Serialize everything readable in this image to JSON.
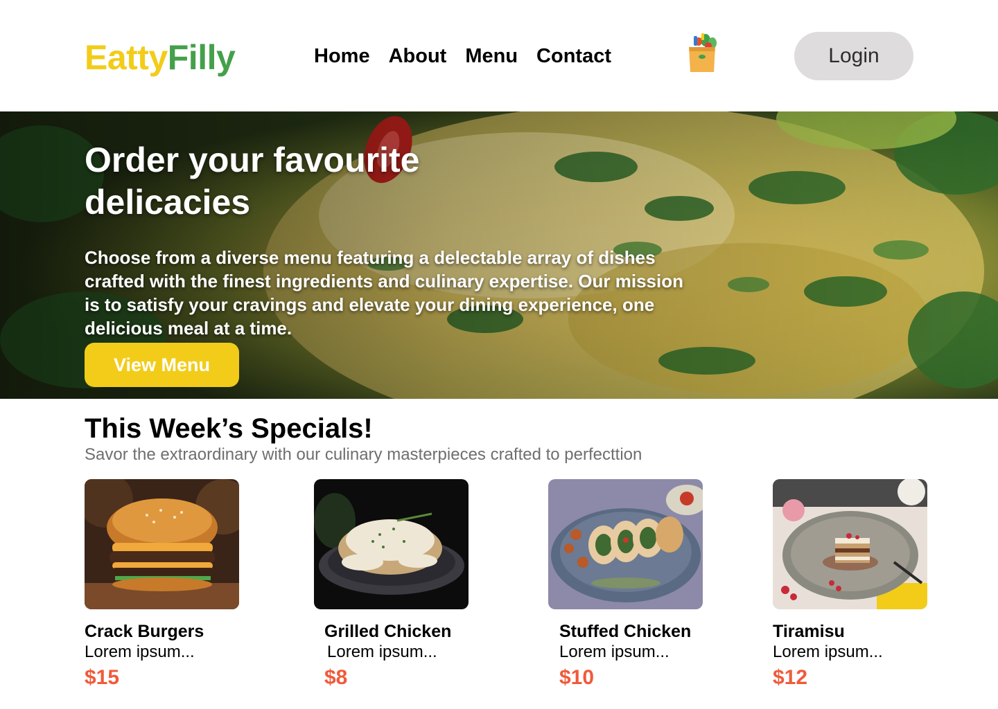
{
  "brand": {
    "part1": "Eatty",
    "part2": "Filly",
    "color1": "#f2cc19",
    "color2": "#44a04a"
  },
  "nav": {
    "items": [
      "Home",
      "About",
      "Menu",
      "Contact"
    ]
  },
  "cart": {
    "icon": "grocery-bag-icon"
  },
  "login": {
    "label": "Login"
  },
  "hero": {
    "title": "Order your favourite delicacies",
    "description": "Choose from a diverse menu featuring a delectable array of dishes crafted with the finest ingredients and culinary expertise. Our mission is to satisfy your cravings and elevate your dining experience, one delicious meal at a time.",
    "button": "View Menu",
    "button_color": "#f2cc19"
  },
  "specials": {
    "title": "This Week’s Specials!",
    "subtitle": "Savor the extraordinary with our culinary masterpieces crafted to perfecttion",
    "items": [
      {
        "name": "Crack Burgers",
        "desc": "Lorem ipsum...",
        "price": "$15",
        "image": "burger-photo"
      },
      {
        "name": "Grilled Chicken",
        "desc": "Lorem ipsum...",
        "price": "$8",
        "image": "grilled-chicken-photo"
      },
      {
        "name": "Stuffed Chicken",
        "desc": "Lorem ipsum...",
        "price": "$10",
        "image": "stuffed-chicken-photo"
      },
      {
        "name": "Tiramisu",
        "desc": "Lorem ipsum...",
        "price": "$12",
        "image": "tiramisu-photo"
      }
    ],
    "price_color": "#f05a3a"
  }
}
